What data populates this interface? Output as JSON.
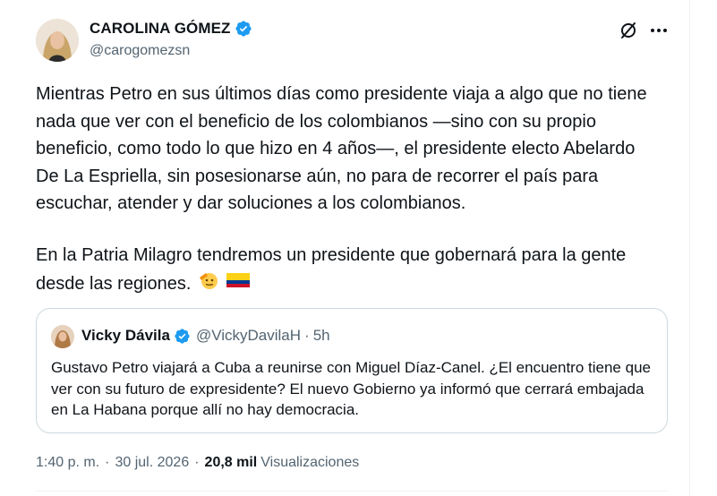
{
  "author": {
    "name": "CAROLINA GÓMEZ",
    "handle": "@carogomezsn"
  },
  "tweet": {
    "paragraph1": "Mientras Petro en sus últimos días como presidente viaja a algo que no tiene nada que ver con el beneficio de los colombianos —sino con su propio beneficio, como todo lo que hizo en 4 años—, el presidente electo Abelardo De La Espriella, sin posesionarse aún, no para de recorrer el país para escuchar, atender y dar soluciones a los colombianos.",
    "paragraph2": "En la Patria Milagro tendremos un presidente que gobernará para la gente desde las regiones."
  },
  "quote": {
    "name": "Vicky Dávila",
    "handle": "@VickyDavilaH",
    "dot": "·",
    "time": "5h",
    "text": "Gustavo Petro viajará a Cuba a reunirse con Miguel Díaz-Canel. ¿El encuentro tiene que ver con su futuro de expresidente? El nuevo Gobierno ya informó que cerrará embajada en La Habana porque allí no hay democracia."
  },
  "meta": {
    "time": "1:40 p. m.",
    "sep": "·",
    "date": "30 jul. 2026",
    "sep2": "·",
    "views_count": "20,8 mil",
    "views_label": "Visualizaciones"
  },
  "icons": {
    "verified_color": "#1d9bf0",
    "grok": "grok-icon",
    "more": "more-icon"
  }
}
